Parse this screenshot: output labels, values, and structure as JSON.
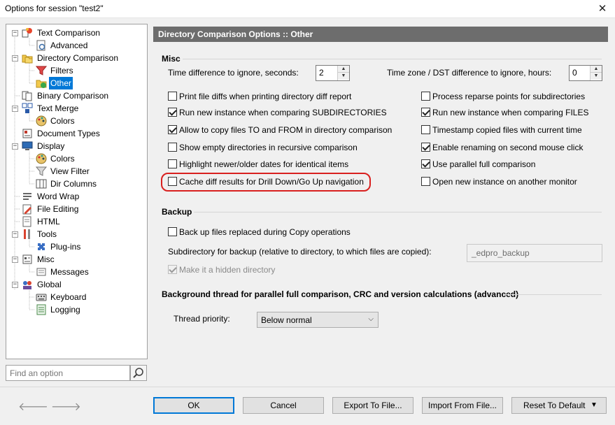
{
  "window": {
    "title": "Options for session \"test2\""
  },
  "tree": {
    "items": [
      {
        "label": "Text Comparison",
        "icon": "text-comparison-icon"
      },
      {
        "label": "Advanced",
        "icon": "advanced-icon"
      },
      {
        "label": "Directory Comparison",
        "icon": "directory-comparison-icon"
      },
      {
        "label": "Filters",
        "icon": "filter-icon"
      },
      {
        "label": "Other",
        "icon": "folder-other-icon"
      },
      {
        "label": "Binary Comparison",
        "icon": "binary-comparison-icon"
      },
      {
        "label": "Text Merge",
        "icon": "text-merge-icon"
      },
      {
        "label": "Colors",
        "icon": "palette-icon"
      },
      {
        "label": "Document Types",
        "icon": "document-types-icon"
      },
      {
        "label": "Display",
        "icon": "monitor-icon"
      },
      {
        "label": "Colors",
        "icon": "palette-icon"
      },
      {
        "label": "View Filter",
        "icon": "filter-icon"
      },
      {
        "label": "Dir Columns",
        "icon": "columns-icon"
      },
      {
        "label": "Word Wrap",
        "icon": "word-wrap-icon"
      },
      {
        "label": "File Editing",
        "icon": "pencil-icon"
      },
      {
        "label": "HTML",
        "icon": "html-icon"
      },
      {
        "label": "Tools",
        "icon": "tools-icon"
      },
      {
        "label": "Plug-ins",
        "icon": "plugin-icon"
      },
      {
        "label": "Misc",
        "icon": "misc-icon"
      },
      {
        "label": "Messages",
        "icon": "messages-icon"
      },
      {
        "label": "Global",
        "icon": "global-icon"
      },
      {
        "label": "Keyboard",
        "icon": "keyboard-icon"
      },
      {
        "label": "Logging",
        "icon": "logging-icon"
      }
    ]
  },
  "search": {
    "placeholder": "Find an option",
    "button_icon": "search-icon"
  },
  "panel": {
    "header": "Directory Comparison Options :: Other",
    "misc": {
      "title": "Misc",
      "time_diff_label": "Time difference to ignore, seconds:",
      "time_diff_value": "2",
      "timezone_label": "Time zone / DST difference to ignore, hours:",
      "timezone_value": "0",
      "left_options": [
        {
          "label": "Print file diffs when printing directory diff report",
          "checked": false
        },
        {
          "label": "Run new instance when comparing SUBDIRECTORIES",
          "checked": true
        },
        {
          "label": "Allow to copy files TO and FROM in directory comparison",
          "checked": true
        },
        {
          "label": "Show empty directories in recursive comparison",
          "checked": false
        },
        {
          "label": "Highlight newer/older dates for identical items",
          "checked": false
        },
        {
          "label": "Cache diff results for Drill Down/Go Up navigation",
          "checked": false
        }
      ],
      "right_options": [
        {
          "label": "Process reparse points for subdirectories",
          "checked": false
        },
        {
          "label": "Run new instance when comparing FILES",
          "checked": true
        },
        {
          "label": "Timestamp copied files with current time",
          "checked": false
        },
        {
          "label": "Enable renaming on second mouse click",
          "checked": true
        },
        {
          "label": "Use parallel full comparison",
          "checked": true
        },
        {
          "label": "Open new instance on another monitor",
          "checked": false
        }
      ]
    },
    "backup": {
      "title": "Backup",
      "backup_files_label": "Back up files replaced during Copy operations",
      "backup_files_checked": false,
      "subdir_label": "Subdirectory for backup (relative to directory, to which files are copied):",
      "subdir_value": "_edpro_backup",
      "hidden_label": "Make it a hidden directory",
      "hidden_checked": true
    },
    "background": {
      "title": "Background thread for parallel full comparison, CRC and version calculations (advanced)",
      "priority_label": "Thread priority:",
      "priority_value": "Below normal"
    }
  },
  "buttons": {
    "ok": "OK",
    "cancel": "Cancel",
    "export": "Export To File...",
    "import": "Import From File...",
    "reset": "Reset To Default"
  },
  "colors": {
    "selection": "#0078d7",
    "header_bg": "#6d6d6d",
    "highlight_ring": "#d9201f"
  }
}
